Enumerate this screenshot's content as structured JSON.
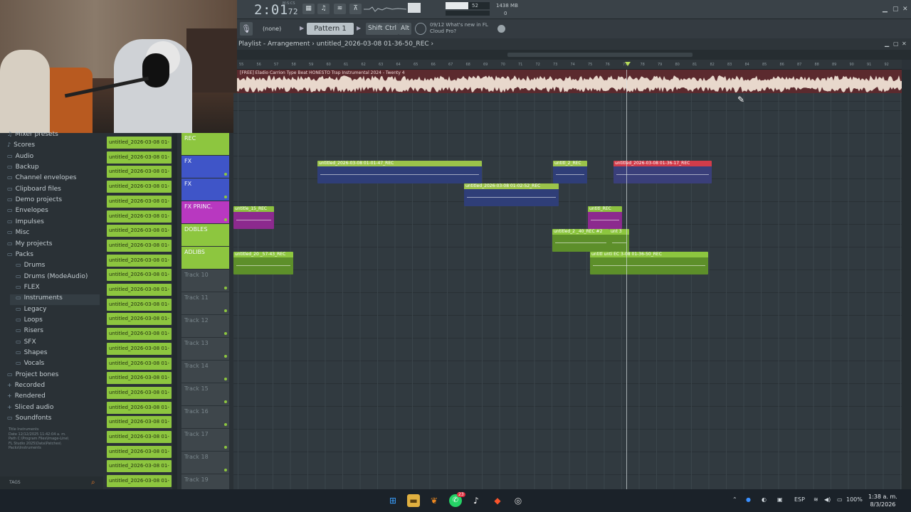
{
  "toolbar": {
    "time": "2:01",
    "time_small": "72",
    "time_unit": "M:S:CS",
    "cpu_value": "52",
    "ram_value": "1438 MB",
    "ram_value2": "0",
    "btn_piano": "▦",
    "btn_pattern": "♫",
    "btn_mixer": "≋",
    "btn_channel": "⊼"
  },
  "toolbar2": {
    "mic": "🎙",
    "pattern_none": "(none)",
    "pattern": "Pattern 1",
    "shift": "Shift",
    "ctrl": "Ctrl",
    "alt": "Alt",
    "news_line1": "09/12  What's new in FL",
    "news_line2": "Cloud Pro?"
  },
  "playlist": {
    "title": "Playlist - Arrangement",
    "project": "untitled_2026-03-08 01-36-50_REC",
    "audio_label": "[FREE] Eladio Carrion Type Beat  HONESTO  Trap Instrumental 2024 - Twenty 4"
  },
  "ruler_ticks": [
    "55",
    "56",
    "57",
    "58",
    "59",
    "60",
    "61",
    "62",
    "63",
    "64",
    "65",
    "66",
    "67",
    "68",
    "69",
    "70",
    "71",
    "72",
    "73",
    "74",
    "75",
    "76",
    "77",
    "78",
    "79",
    "80",
    "81",
    "82",
    "83",
    "84",
    "85",
    "86",
    "87",
    "88",
    "89",
    "90",
    "91",
    "92"
  ],
  "browser": {
    "items": [
      {
        "label": "Mixer presets",
        "icon": "♫",
        "sub": false
      },
      {
        "label": "Scores",
        "icon": "♪",
        "sub": false
      },
      {
        "label": "Audio",
        "icon": "▭",
        "sub": false
      },
      {
        "label": "Backup",
        "icon": "▭",
        "sub": false
      },
      {
        "label": "Channel envelopes",
        "icon": "▭",
        "sub": false
      },
      {
        "label": "Clipboard files",
        "icon": "▭",
        "sub": false
      },
      {
        "label": "Demo projects",
        "icon": "▭",
        "sub": false
      },
      {
        "label": "Envelopes",
        "icon": "▭",
        "sub": false
      },
      {
        "label": "Impulses",
        "icon": "▭",
        "sub": false
      },
      {
        "label": "Misc",
        "icon": "▭",
        "sub": false
      },
      {
        "label": "My projects",
        "icon": "▭",
        "sub": false
      },
      {
        "label": "Packs",
        "icon": "▭",
        "sub": false
      },
      {
        "label": "Drums",
        "icon": "▭",
        "sub": true
      },
      {
        "label": "Drums (ModeAudio)",
        "icon": "▭",
        "sub": true
      },
      {
        "label": "FLEX",
        "icon": "▭",
        "sub": true
      },
      {
        "label": "Instruments",
        "icon": "▭",
        "sub": true
      },
      {
        "label": "Legacy",
        "icon": "▭",
        "sub": true
      },
      {
        "label": "Loops",
        "icon": "▭",
        "sub": true
      },
      {
        "label": "Risers",
        "icon": "▭",
        "sub": true
      },
      {
        "label": "SFX",
        "icon": "▭",
        "sub": true
      },
      {
        "label": "Shapes",
        "icon": "▭",
        "sub": true
      },
      {
        "label": "Vocals",
        "icon": "▭",
        "sub": true
      },
      {
        "label": "Project bones",
        "icon": "▭",
        "sub": false
      },
      {
        "label": "Recorded",
        "icon": "+",
        "sub": false
      },
      {
        "label": "Rendered",
        "icon": "+",
        "sub": false
      },
      {
        "label": "Sliced audio",
        "icon": "+",
        "sub": false
      },
      {
        "label": "Soundfonts",
        "icon": "▭",
        "sub": false
      }
    ],
    "info_title": "Title      Instruments",
    "info_date": "Date       12/12/2025 11:42:04 a. m.",
    "info_path": "Path      C:\\Program Files\\Image-Line\\",
    "info_path2": "FL Studio 2025\\Data\\Patches\\",
    "info_path3": "Packs\\Instruments",
    "tags": "TAGS"
  },
  "clips": {
    "label": "untitled_2026-03-08 01-"
  },
  "tracks": [
    {
      "name": "REC",
      "color": "#8dc63f"
    },
    {
      "name": "FX",
      "color": "#3f55c8"
    },
    {
      "name": "FX",
      "color": "#3f55c8"
    },
    {
      "name": "FX PRINC.",
      "color": "#b838c0"
    },
    {
      "name": "DOBLES",
      "color": "#8dc63f"
    },
    {
      "name": "ADLIBS",
      "color": "#8dc63f"
    },
    {
      "name": "Track 10",
      "color": ""
    },
    {
      "name": "Track 11",
      "color": ""
    },
    {
      "name": "Track 12",
      "color": ""
    },
    {
      "name": "Track 13",
      "color": ""
    },
    {
      "name": "Track 14",
      "color": ""
    },
    {
      "name": "Track 15",
      "color": ""
    },
    {
      "name": "Track 16",
      "color": ""
    },
    {
      "name": "Track 17",
      "color": ""
    },
    {
      "name": "Track 18",
      "color": ""
    },
    {
      "name": "Track 19",
      "color": ""
    }
  ],
  "playlist_clips": [
    {
      "label": "untitled_2026-03-08 01-01-47_REC",
      "style": "blue"
    },
    {
      "label": "untitl_2_REC",
      "style": "blue"
    },
    {
      "label": "untitled_2026-03-08 01-36-17_REC",
      "style": "red"
    },
    {
      "label": "untitled_2026-03-08 01-02-52_REC",
      "style": "blue"
    },
    {
      "label": "untitle_15_REC",
      "style": "pink"
    },
    {
      "label": "untitl_REC",
      "style": "pink"
    },
    {
      "label": "untitled_2 _40_REC #2",
      "style": "green"
    },
    {
      "label": "unt 3",
      "style": "green"
    },
    {
      "label": "untitled_20 _57-43_REC",
      "style": "green"
    },
    {
      "label": "untitl unti EC 3-08 01-36-50_REC",
      "style": "green"
    }
  ],
  "taskbar": {
    "lang": "ESP",
    "battery": "100%",
    "time": "1:38 a. m.",
    "date": "8/3/2026",
    "badge": "23"
  }
}
